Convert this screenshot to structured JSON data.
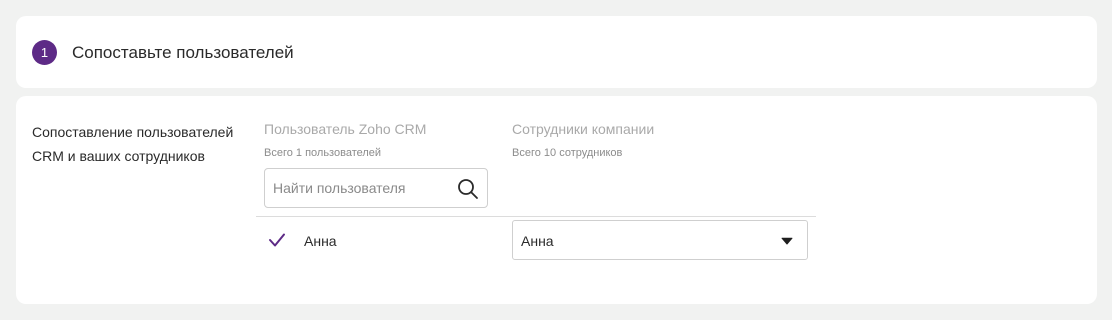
{
  "step": {
    "number": "1",
    "title": "Сопоставьте пользователей"
  },
  "mapping": {
    "side_label": "Сопоставление пользователей CRM и ваших сотрудников",
    "crm_column": {
      "header": "Пользователь Zoho CRM",
      "count": "Всего 1 пользователей"
    },
    "staff_column": {
      "header": "Сотрудники компании",
      "count": "Всего 10 сотрудников"
    },
    "search": {
      "placeholder": "Найти пользователя",
      "value": ""
    },
    "rows": [
      {
        "crm_user": "Анна",
        "checked": true,
        "employee": "Анна"
      }
    ]
  },
  "colors": {
    "accent": "#5d2a86",
    "background": "#f1f2f1",
    "card": "#ffffff"
  },
  "icons": {
    "search": "search-icon",
    "check": "check-icon",
    "dropdown": "caret-down-icon"
  }
}
